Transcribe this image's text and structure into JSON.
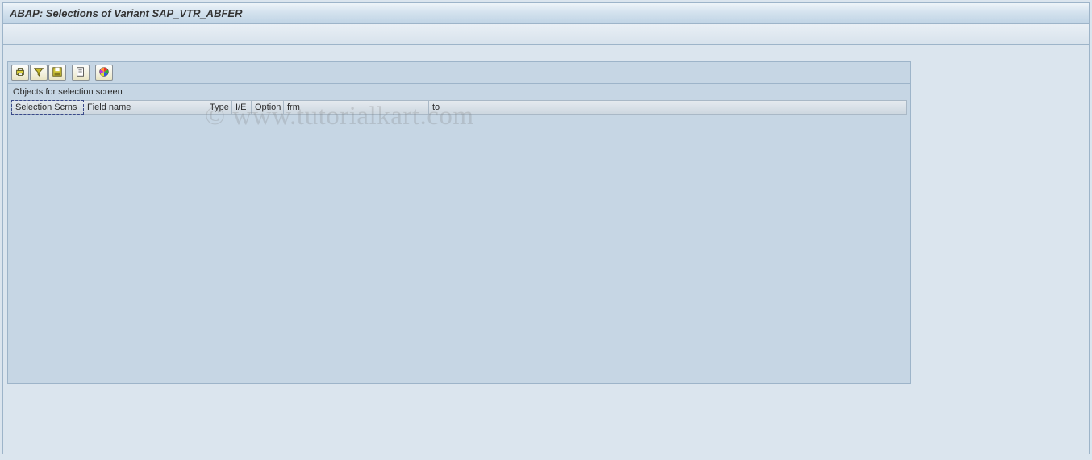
{
  "header": {
    "title": "ABAP: Selections of Variant SAP_VTR_ABFER"
  },
  "toolbar": {
    "buttons": [
      {
        "name": "print-icon"
      },
      {
        "name": "filter-icon"
      },
      {
        "name": "save-icon"
      },
      {
        "name": "page-icon"
      },
      {
        "name": "color-legend-icon"
      }
    ]
  },
  "section": {
    "label": "Objects for selection screen"
  },
  "table": {
    "columns": [
      {
        "key": "scrns",
        "label": "Selection Scrns"
      },
      {
        "key": "field",
        "label": "Field name"
      },
      {
        "key": "type",
        "label": "Type"
      },
      {
        "key": "ie",
        "label": "I/E"
      },
      {
        "key": "option",
        "label": "Option"
      },
      {
        "key": "frm",
        "label": "frm"
      },
      {
        "key": "to",
        "label": "to"
      }
    ]
  },
  "watermark": "© www.tutorialkart.com"
}
